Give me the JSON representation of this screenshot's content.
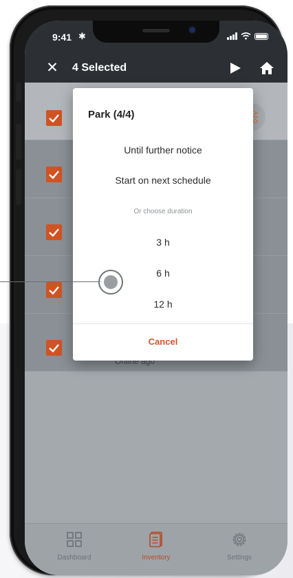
{
  "status_bar": {
    "time": "9:41"
  },
  "header": {
    "title": "4 Selected"
  },
  "dialog": {
    "title": "Park (4/4)",
    "options_top": [
      "Until further notice",
      "Start on next schedule"
    ],
    "hint": "Or choose duration",
    "durations": [
      "3 h",
      "6 h",
      "12 h"
    ],
    "cancel_label": "Cancel"
  },
  "list": {
    "row_subtitle": "Online ago"
  },
  "nav": {
    "items": [
      {
        "label": "Dashboard",
        "icon": "grid-icon"
      },
      {
        "label": "Inventory",
        "icon": "inventory-icon",
        "active": true
      },
      {
        "label": "Settings",
        "icon": "gear-icon"
      }
    ]
  },
  "colors": {
    "accent": "#cf5424",
    "header_bg": "#2c3035",
    "overlay_bg": "#a4a9ae",
    "dialog_bg": "#ffffff",
    "cancel_text": "#d2552a"
  }
}
